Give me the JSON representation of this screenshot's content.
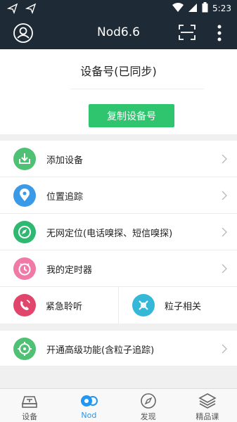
{
  "status_bar": {
    "time": "5:23"
  },
  "app_bar": {
    "title": "Nod6.6"
  },
  "device_card": {
    "title": "设备号(已同步)",
    "copy_label": "复制设备号"
  },
  "menu": {
    "add_device": "添加设备",
    "location_tracking": "位置追踪",
    "offline_location": "无网定位(电话嗅探、短信嗅探)",
    "my_timer": "我的定时器",
    "emergency_listen": "紧急聆听",
    "particle_related": "粒子相关",
    "advanced_features": "开通高级功能(含粒子追踪)"
  },
  "tabs": [
    {
      "label": "设备",
      "icon": "device-icon",
      "active": false
    },
    {
      "label": "Nod",
      "icon": "nod-icon",
      "active": true
    },
    {
      "label": "发现",
      "icon": "compass-icon",
      "active": false
    },
    {
      "label": "精品课",
      "icon": "layers-icon",
      "active": false
    }
  ],
  "colors": {
    "header": "#1e2a36",
    "accent_green": "#2ec56e",
    "tab_active": "#2196f3"
  }
}
